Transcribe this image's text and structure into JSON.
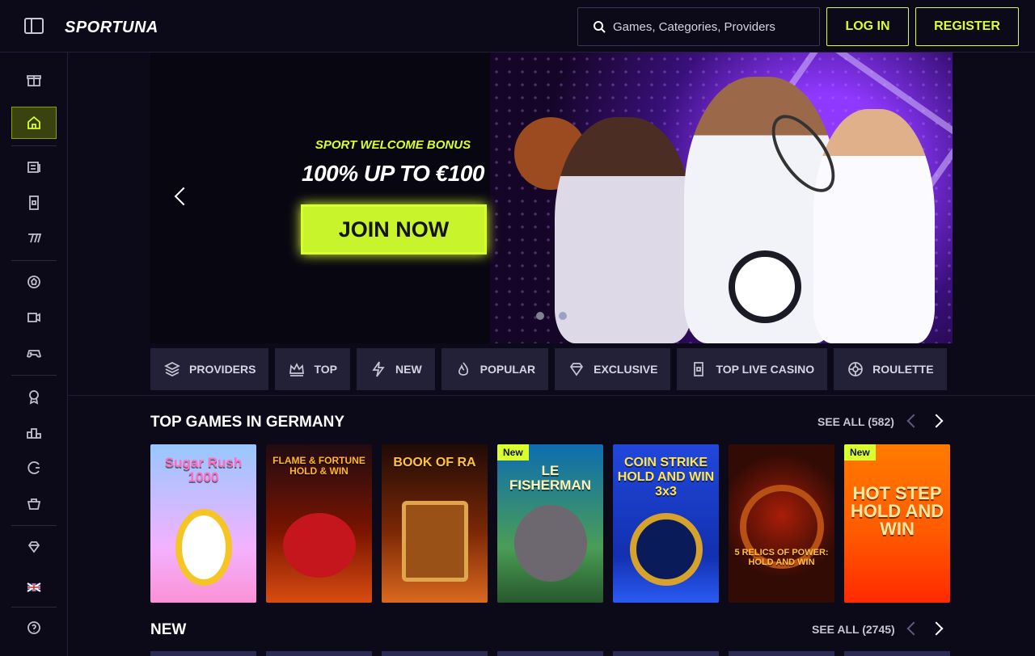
{
  "brand": {
    "logo": "SPORTUNA"
  },
  "header": {
    "search_placeholder": "Games, Categories, Providers",
    "login": "LOG IN",
    "register": "REGISTER"
  },
  "sidebar": {
    "language": "English"
  },
  "banner": {
    "kicker": "SPORT WELCOME BONUS",
    "headline": "100% UP TO €100",
    "cta": "JOIN NOW"
  },
  "categories": [
    "PROVIDERS",
    "TOP",
    "NEW",
    "POPULAR",
    "EXCLUSIVE",
    "TOP LIVE CASINO",
    "ROULETTE"
  ],
  "sections": {
    "top_games": {
      "title": "TOP GAMES IN GERMANY",
      "see_all": "SEE ALL (582)"
    },
    "new": {
      "title": "NEW",
      "see_all": "SEE ALL (2745)"
    }
  },
  "games": [
    {
      "title": "Sugar Rush 1000",
      "tag": ""
    },
    {
      "title": "FLAME & FORTUNE HOLD & WIN",
      "tag": ""
    },
    {
      "title": "BOOK OF RA",
      "tag": ""
    },
    {
      "title": "LE FISHERMAN",
      "tag": "New"
    },
    {
      "title": "COIN STRIKE HOLD AND WIN 3x3",
      "tag": ""
    },
    {
      "title": "5 RELICS OF POWER: HOLD AND WIN",
      "tag": ""
    },
    {
      "title": "HOT STEP HOLD AND WIN",
      "tag": "New"
    }
  ],
  "colors": {
    "accent": "#D9FF2F",
    "background": "#0C0A18",
    "card": "#232137"
  },
  "icons": [
    "menu-icon",
    "gift-icon",
    "home-icon",
    "news-icon",
    "card-icon",
    "seven-icon",
    "soccer-ball-icon",
    "video-icon",
    "gamepad-icon",
    "badge-icon",
    "podium-icon",
    "c-icon",
    "shop-icon",
    "diamond-icon",
    "uk-flag-icon",
    "help-icon"
  ]
}
